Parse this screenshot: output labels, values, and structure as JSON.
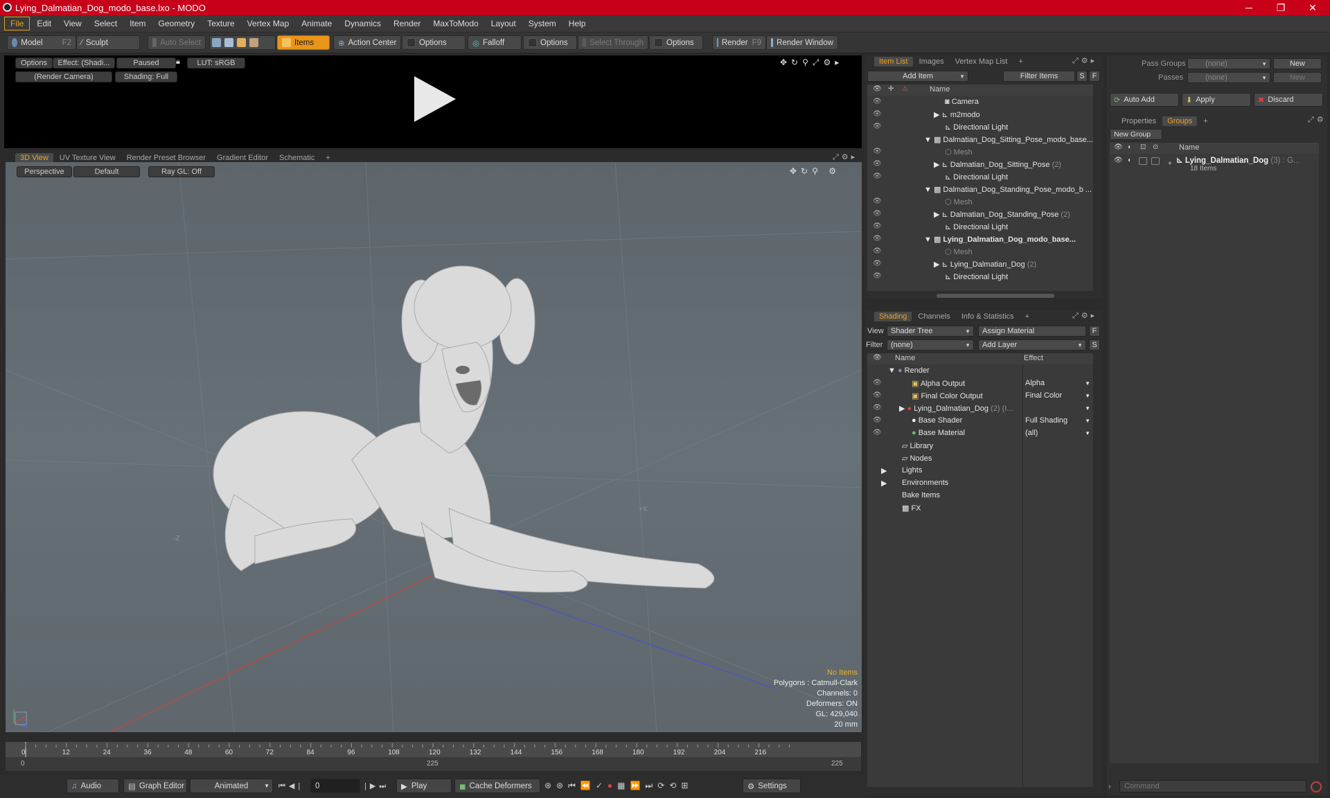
{
  "window": {
    "title": "Lying_Dalmatian_Dog_modo_base.lxo - MODO",
    "controls": [
      "─",
      "❐",
      "✕"
    ]
  },
  "menu": [
    "File",
    "Edit",
    "View",
    "Select",
    "Item",
    "Geometry",
    "Texture",
    "Vertex Map",
    "Animate",
    "Dynamics",
    "Render",
    "MaxToModo",
    "Layout",
    "System",
    "Help"
  ],
  "toolbar": {
    "model": "Model",
    "model_key": "F2",
    "sculpt": "Sculpt",
    "auto_select": "Auto Select",
    "items": "Items",
    "action_center": "Action Center",
    "options1": "Options",
    "falloff": "Falloff",
    "options2": "Options",
    "select_through": "Select Through",
    "options3": "Options",
    "render": "Render",
    "render_key": "F9",
    "render_window": "Render Window"
  },
  "preview": {
    "options": "Options",
    "effect": "Effect: (Shadi...",
    "paused": "Paused",
    "lut": "LUT: sRGB",
    "camera": "(Render Camera)",
    "shading": "Shading: Full"
  },
  "viewport_tabs": [
    "3D View",
    "UV Texture View",
    "Render Preset Browser",
    "Gradient Editor",
    "Schematic",
    "+"
  ],
  "viewport": {
    "perspective": "Perspective",
    "default": "Default",
    "raygl": "Ray GL: Off",
    "axis_x": "+X",
    "axis_z": "-Z",
    "stats": {
      "no_items": "No Items",
      "polygons": "Polygons : Catmull-Clark",
      "channels": "Channels: 0",
      "deformers": "Deformers: ON",
      "gl": "GL: 429,040",
      "unit": "20 mm"
    }
  },
  "item_list": {
    "tabs": [
      "Item List",
      "Images",
      "Vertex Map List",
      "+"
    ],
    "add_item": "Add Item",
    "filter_items": "Filter Items",
    "s_btn": "S",
    "f_btn": "F",
    "col_name": "Name",
    "rows": [
      {
        "name": "Camera",
        "suffix": ""
      },
      {
        "name": "m2modo",
        "suffix": ""
      },
      {
        "name": "Directional Light",
        "suffix": ""
      },
      {
        "name": "Dalmatian_Dog_Sitting_Pose_modo_base...",
        "suffix": ""
      },
      {
        "name": "Mesh",
        "suffix": ""
      },
      {
        "name": "Dalmatian_Dog_Sitting_Pose",
        "suffix": "(2)"
      },
      {
        "name": "Directional Light",
        "suffix": ""
      },
      {
        "name": "Dalmatian_Dog_Standing_Pose_modo_b ...",
        "suffix": ""
      },
      {
        "name": "Mesh",
        "suffix": ""
      },
      {
        "name": "Dalmatian_Dog_Standing_Pose",
        "suffix": "(2)"
      },
      {
        "name": "Directional Light",
        "suffix": ""
      },
      {
        "name": "Lying_Dalmatian_Dog_modo_base...",
        "suffix": ""
      },
      {
        "name": "Mesh",
        "suffix": ""
      },
      {
        "name": "Lying_Dalmatian_Dog",
        "suffix": "(2)"
      },
      {
        "name": "Directional Light",
        "suffix": ""
      }
    ]
  },
  "shading": {
    "tabs": [
      "Shading",
      "Channels",
      "Info & Statistics",
      "+"
    ],
    "view_label": "View",
    "view_value": "Shader Tree",
    "assign_material": "Assign Material",
    "filter_label": "Filter",
    "filter_value": "(none)",
    "add_layer": "Add Layer",
    "f_btn": "F",
    "s_btn": "S",
    "col_name": "Name",
    "col_effect": "Effect",
    "rows": [
      {
        "name": "Render",
        "effect": ""
      },
      {
        "name": "Alpha Output",
        "effect": "Alpha"
      },
      {
        "name": "Final Color Output",
        "effect": "Final Color"
      },
      {
        "name": "Lying_Dalmatian_Dog",
        "suffix": "(2) (I...",
        "effect": ""
      },
      {
        "name": "Base Shader",
        "effect": "Full Shading"
      },
      {
        "name": "Base Material",
        "effect": "(all)"
      },
      {
        "name": "Library",
        "effect": ""
      },
      {
        "name": "Nodes",
        "effect": ""
      },
      {
        "name": "Lights",
        "effect": ""
      },
      {
        "name": "Environments",
        "effect": ""
      },
      {
        "name": "Bake Items",
        "effect": ""
      },
      {
        "name": "FX",
        "effect": ""
      }
    ]
  },
  "groups_panel": {
    "pass_groups_label": "Pass Groups",
    "pass_groups_value": "(none)",
    "new1": "New",
    "passes_label": "Passes",
    "passes_value": "(none)",
    "new2": "New",
    "auto_add": "Auto Add",
    "apply": "Apply",
    "discard": "Discard",
    "tabs": [
      "Properties",
      "Groups",
      "+"
    ],
    "new_group": "New Group",
    "col_name": "Name",
    "group_name": "Lying_Dalmatian_Dog",
    "group_suffix": "(3) : G...",
    "group_count": "18 Items"
  },
  "timeline": {
    "ticks": [
      "0",
      "12",
      "24",
      "36",
      "48",
      "60",
      "72",
      "84",
      "96",
      "108",
      "120",
      "132",
      "144",
      "156",
      "168",
      "180",
      "192",
      "204",
      "216"
    ],
    "start": "0",
    "mid": "225",
    "end": "225"
  },
  "bottombar": {
    "audio": "Audio",
    "graph_editor": "Graph Editor",
    "animated": "Animated",
    "frame": "0",
    "play": "Play",
    "cache_deformers": "Cache Deformers",
    "settings": "Settings"
  },
  "command": {
    "placeholder": "Command"
  },
  "colors": {
    "accent": "#e8951a",
    "title_red": "#c8001a",
    "tab_orange": "#f0a020"
  }
}
